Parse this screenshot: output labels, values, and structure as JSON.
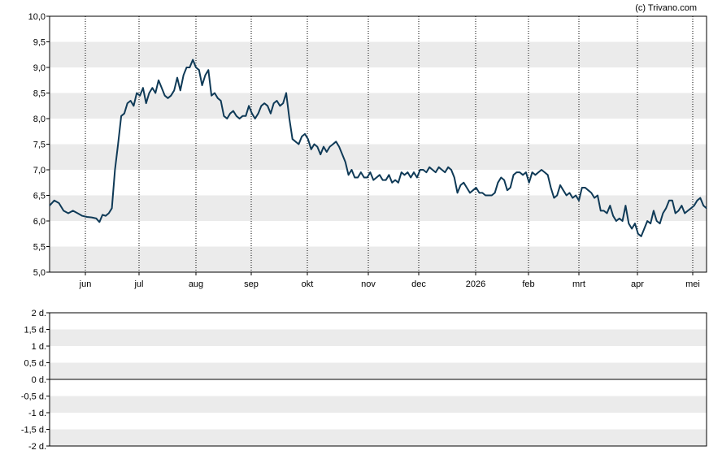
{
  "credit": "(c) Trivano.com",
  "colors": {
    "line": "#0f3a57",
    "band": "#ebebeb",
    "axis": "#000000",
    "grid": "#000000"
  },
  "chart_data": [
    {
      "type": "line",
      "title": "",
      "xlabel": "",
      "ylabel": "",
      "ylim": [
        5.0,
        10.0
      ],
      "y_ticks": [
        "5,0",
        "5,5",
        "6,0",
        "6,5",
        "7,0",
        "7,5",
        "8,0",
        "8,5",
        "9,0",
        "9,5",
        "10,0"
      ],
      "x_ticks": [
        "jun",
        "jul",
        "aug",
        "sep",
        "okt",
        "nov",
        "dec",
        "2026",
        "feb",
        "mrt",
        "apr",
        "mei"
      ],
      "grid": "vertical dotted at month starts, alternating horizontal bands",
      "series": [
        {
          "values": [
            [
              0.0,
              6.3
            ],
            [
              1.5,
              6.4
            ],
            [
              3.0,
              6.35
            ],
            [
              4.5,
              6.2
            ],
            [
              6.0,
              6.15
            ],
            [
              7.5,
              6.2
            ],
            [
              9.0,
              6.15
            ],
            [
              10.5,
              6.1
            ],
            [
              12.0,
              6.08
            ],
            [
              13.5,
              6.07
            ],
            [
              15.0,
              6.05
            ],
            [
              16.0,
              5.98
            ],
            [
              17.0,
              6.12
            ],
            [
              18.0,
              6.1
            ],
            [
              19.0,
              6.15
            ],
            [
              20.0,
              6.25
            ],
            [
              21.0,
              7.0
            ],
            [
              22.0,
              7.5
            ],
            [
              23.0,
              8.05
            ],
            [
              24.0,
              8.1
            ],
            [
              25.0,
              8.3
            ],
            [
              26.0,
              8.35
            ],
            [
              27.0,
              8.25
            ],
            [
              28.0,
              8.5
            ],
            [
              29.0,
              8.45
            ],
            [
              30.0,
              8.6
            ],
            [
              31.0,
              8.3
            ],
            [
              32.0,
              8.5
            ],
            [
              33.0,
              8.6
            ],
            [
              34.0,
              8.5
            ],
            [
              35.0,
              8.75
            ],
            [
              36.0,
              8.6
            ],
            [
              37.0,
              8.45
            ],
            [
              38.0,
              8.4
            ],
            [
              39.0,
              8.45
            ],
            [
              40.0,
              8.55
            ],
            [
              41.0,
              8.8
            ],
            [
              42.0,
              8.55
            ],
            [
              43.0,
              8.85
            ],
            [
              44.0,
              9.0
            ],
            [
              45.0,
              9.0
            ],
            [
              46.0,
              9.15
            ],
            [
              47.0,
              9.0
            ],
            [
              48.0,
              8.95
            ],
            [
              49.0,
              8.65
            ],
            [
              50.0,
              8.85
            ],
            [
              51.0,
              8.95
            ],
            [
              52.0,
              8.45
            ],
            [
              53.0,
              8.5
            ],
            [
              54.0,
              8.4
            ],
            [
              55.0,
              8.35
            ],
            [
              56.0,
              8.05
            ],
            [
              57.0,
              8.0
            ],
            [
              58.0,
              8.1
            ],
            [
              59.0,
              8.15
            ],
            [
              60.0,
              8.05
            ],
            [
              61.0,
              8.0
            ],
            [
              62.0,
              8.05
            ],
            [
              63.0,
              8.05
            ],
            [
              64.0,
              8.25
            ],
            [
              65.0,
              8.1
            ],
            [
              66.0,
              8.0
            ],
            [
              67.0,
              8.1
            ],
            [
              68.0,
              8.25
            ],
            [
              69.0,
              8.3
            ],
            [
              70.0,
              8.25
            ],
            [
              71.0,
              8.1
            ],
            [
              72.0,
              8.3
            ],
            [
              73.0,
              8.35
            ],
            [
              74.0,
              8.25
            ],
            [
              75.0,
              8.3
            ],
            [
              76.0,
              8.5
            ],
            [
              77.0,
              8.0
            ],
            [
              78.0,
              7.6
            ],
            [
              79.0,
              7.55
            ],
            [
              80.0,
              7.5
            ],
            [
              81.0,
              7.65
            ],
            [
              82.0,
              7.7
            ],
            [
              83.0,
              7.6
            ],
            [
              84.0,
              7.4
            ],
            [
              85.0,
              7.5
            ],
            [
              86.0,
              7.45
            ],
            [
              87.0,
              7.3
            ],
            [
              88.0,
              7.45
            ],
            [
              89.0,
              7.35
            ],
            [
              90.0,
              7.45
            ],
            [
              91.0,
              7.5
            ],
            [
              92.0,
              7.55
            ],
            [
              93.0,
              7.45
            ],
            [
              94.0,
              7.3
            ],
            [
              95.0,
              7.15
            ],
            [
              96.0,
              6.9
            ],
            [
              97.0,
              7.0
            ],
            [
              98.0,
              6.85
            ],
            [
              99.0,
              6.85
            ],
            [
              100.0,
              6.95
            ],
            [
              101.0,
              6.85
            ],
            [
              102.0,
              6.85
            ],
            [
              103.0,
              6.95
            ],
            [
              104.0,
              6.8
            ],
            [
              105.0,
              6.85
            ],
            [
              106.0,
              6.9
            ],
            [
              107.0,
              6.8
            ],
            [
              108.0,
              6.8
            ],
            [
              109.0,
              6.9
            ],
            [
              110.0,
              6.75
            ],
            [
              111.0,
              6.8
            ],
            [
              112.0,
              6.75
            ],
            [
              113.0,
              6.95
            ],
            [
              114.0,
              6.9
            ],
            [
              115.0,
              6.95
            ],
            [
              116.0,
              6.85
            ],
            [
              117.0,
              6.95
            ],
            [
              118.0,
              6.85
            ],
            [
              119.0,
              7.0
            ],
            [
              120.0,
              7.0
            ],
            [
              121.0,
              6.95
            ],
            [
              122.0,
              7.05
            ],
            [
              123.0,
              7.0
            ],
            [
              124.0,
              6.95
            ],
            [
              125.0,
              7.05
            ],
            [
              126.0,
              7.0
            ],
            [
              127.0,
              6.95
            ],
            [
              128.0,
              7.05
            ],
            [
              129.0,
              7.0
            ],
            [
              130.0,
              6.85
            ],
            [
              131.0,
              6.55
            ],
            [
              132.0,
              6.7
            ],
            [
              133.0,
              6.75
            ],
            [
              134.0,
              6.65
            ],
            [
              135.0,
              6.55
            ],
            [
              136.0,
              6.6
            ],
            [
              137.0,
              6.65
            ],
            [
              138.0,
              6.55
            ],
            [
              139.0,
              6.55
            ],
            [
              140.0,
              6.5
            ],
            [
              141.0,
              6.5
            ],
            [
              142.0,
              6.5
            ],
            [
              143.0,
              6.55
            ],
            [
              144.0,
              6.75
            ],
            [
              145.0,
              6.85
            ],
            [
              146.0,
              6.8
            ],
            [
              147.0,
              6.6
            ],
            [
              148.0,
              6.65
            ],
            [
              149.0,
              6.9
            ],
            [
              150.0,
              6.95
            ],
            [
              151.0,
              6.95
            ],
            [
              152.0,
              6.9
            ],
            [
              153.0,
              6.95
            ],
            [
              154.0,
              6.75
            ],
            [
              155.0,
              6.95
            ],
            [
              156.0,
              6.9
            ],
            [
              157.0,
              6.95
            ],
            [
              158.0,
              7.0
            ],
            [
              159.0,
              6.95
            ],
            [
              160.0,
              6.9
            ],
            [
              161.0,
              6.65
            ],
            [
              162.0,
              6.45
            ],
            [
              163.0,
              6.5
            ],
            [
              164.0,
              6.7
            ],
            [
              165.0,
              6.6
            ],
            [
              166.0,
              6.5
            ],
            [
              167.0,
              6.55
            ],
            [
              168.0,
              6.45
            ],
            [
              169.0,
              6.5
            ],
            [
              170.0,
              6.4
            ],
            [
              171.0,
              6.65
            ],
            [
              172.0,
              6.65
            ],
            [
              173.0,
              6.6
            ],
            [
              174.0,
              6.55
            ],
            [
              175.0,
              6.45
            ],
            [
              176.0,
              6.5
            ],
            [
              177.0,
              6.2
            ],
            [
              178.0,
              6.2
            ],
            [
              179.0,
              6.15
            ],
            [
              180.0,
              6.3
            ],
            [
              181.0,
              6.1
            ],
            [
              182.0,
              6.0
            ],
            [
              183.0,
              6.05
            ],
            [
              184.0,
              6.0
            ],
            [
              185.0,
              6.3
            ],
            [
              186.0,
              5.95
            ],
            [
              187.0,
              5.85
            ],
            [
              188.0,
              5.95
            ],
            [
              189.0,
              5.75
            ],
            [
              190.0,
              5.7
            ],
            [
              191.0,
              5.85
            ],
            [
              192.0,
              6.0
            ],
            [
              193.0,
              5.95
            ],
            [
              194.0,
              6.2
            ],
            [
              195.0,
              6.0
            ],
            [
              196.0,
              5.95
            ],
            [
              197.0,
              6.15
            ],
            [
              198.0,
              6.25
            ],
            [
              199.0,
              6.4
            ],
            [
              200.0,
              6.4
            ],
            [
              201.0,
              6.15
            ],
            [
              202.0,
              6.2
            ],
            [
              203.0,
              6.3
            ],
            [
              204.0,
              6.15
            ],
            [
              205.0,
              6.2
            ],
            [
              206.0,
              6.25
            ],
            [
              207.0,
              6.3
            ],
            [
              208.0,
              6.4
            ],
            [
              209.0,
              6.45
            ],
            [
              210.0,
              6.3
            ],
            [
              211.0,
              6.25
            ]
          ]
        }
      ]
    },
    {
      "type": "line",
      "title": "",
      "xlabel": "",
      "ylabel": "",
      "ylim": [
        -2,
        2
      ],
      "y_ticks": [
        "2 d.",
        "1,5 d.",
        "1 d.",
        "0,5 d.",
        "0 d.",
        "-0,5 d.",
        "-1 d.",
        "-1,5 d.",
        "-2 d."
      ],
      "grid": "alternating horizontal bands",
      "series": []
    }
  ]
}
